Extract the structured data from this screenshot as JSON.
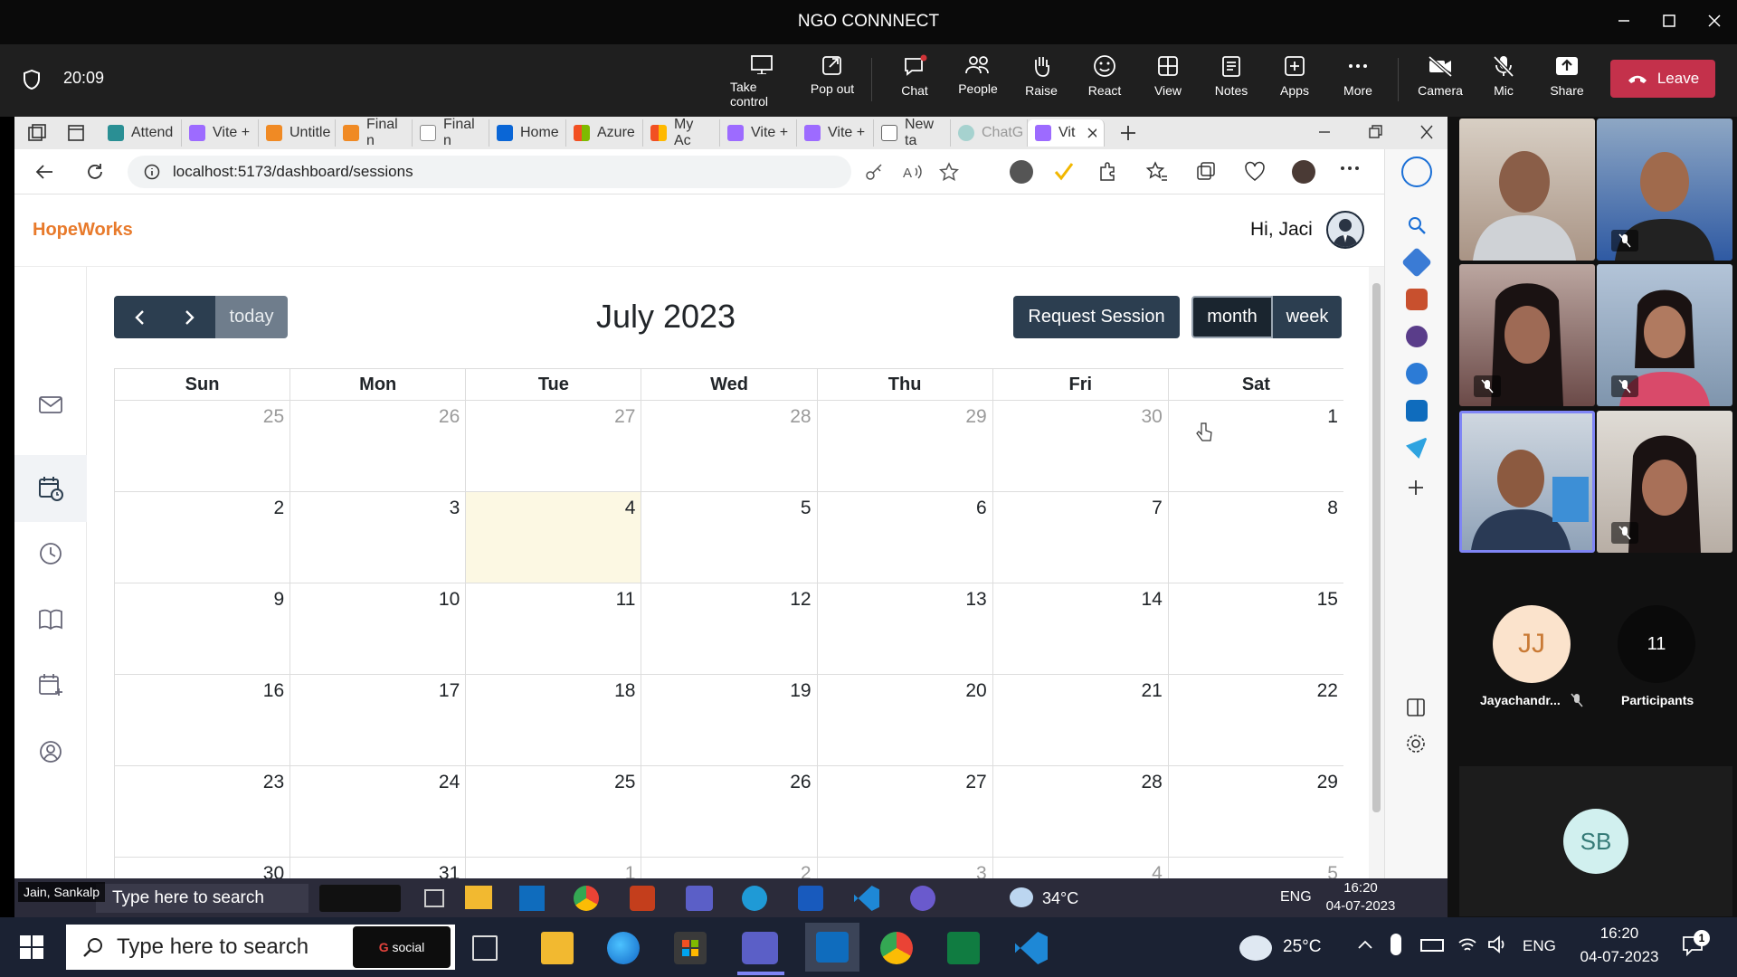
{
  "teams": {
    "title": "NGO CONNNECT",
    "timer": "20:09",
    "toolbar": [
      {
        "label": "Take control",
        "icon": "take-control-icon"
      },
      {
        "label": "Pop out",
        "icon": "pop-out-icon"
      },
      {
        "label": "Chat",
        "icon": "chat-icon"
      },
      {
        "label": "People",
        "icon": "people-icon"
      },
      {
        "label": "Raise",
        "icon": "raise-hand-icon"
      },
      {
        "label": "React",
        "icon": "react-icon"
      },
      {
        "label": "View",
        "icon": "view-icon"
      },
      {
        "label": "Notes",
        "icon": "notes-icon"
      },
      {
        "label": "Apps",
        "icon": "apps-icon"
      },
      {
        "label": "More",
        "icon": "more-icon"
      },
      {
        "label": "Camera",
        "icon": "camera-off-icon"
      },
      {
        "label": "Mic",
        "icon": "mic-off-icon"
      },
      {
        "label": "Share",
        "icon": "share-icon"
      }
    ],
    "leave_label": "Leave",
    "presenter_name": "Jain, Sankalp",
    "participant_initials_jj": "JJ",
    "participant_name_jj": "Jayachandr...",
    "participant_count": "11",
    "participants_label": "Participants",
    "initials_sb": "SB"
  },
  "browser": {
    "tabs": [
      "Attend",
      "Vite +",
      "Untitle",
      "Final n",
      "Final n",
      "Home",
      "Azure",
      "My Ac",
      "Vite +",
      "Vite +",
      "New ta",
      "ChatG",
      "Vit"
    ],
    "url": "localhost:5173/dashboard/sessions"
  },
  "app": {
    "brand": "HopeWorks",
    "greeting": "Hi, Jaci",
    "today_label": "today",
    "month_title": "July 2023",
    "request_label": "Request Session",
    "month_label": "month",
    "week_label": "week",
    "weekdays": [
      "Sun",
      "Mon",
      "Tue",
      "Wed",
      "Thu",
      "Fri",
      "Sat"
    ],
    "weeks": [
      [
        "25",
        "26",
        "27",
        "28",
        "29",
        "30",
        "1"
      ],
      [
        "2",
        "3",
        "4",
        "5",
        "6",
        "7",
        "8"
      ],
      [
        "9",
        "10",
        "11",
        "12",
        "13",
        "14",
        "15"
      ],
      [
        "16",
        "17",
        "18",
        "19",
        "20",
        "21",
        "22"
      ],
      [
        "23",
        "24",
        "25",
        "26",
        "27",
        "28",
        "29"
      ],
      [
        "30",
        "31",
        "1",
        "2",
        "3",
        "4",
        "5"
      ]
    ]
  },
  "inner_taskbar": {
    "search": "Type here to search",
    "weather": "34°C",
    "lang": "ENG",
    "time": "16:20",
    "date": "04-07-2023"
  },
  "taskbar": {
    "search": "Type here to search",
    "social": "social",
    "weather": "25°C",
    "lang": "ENG",
    "time": "16:20",
    "date": "04-07-2023",
    "notifications": "1"
  }
}
